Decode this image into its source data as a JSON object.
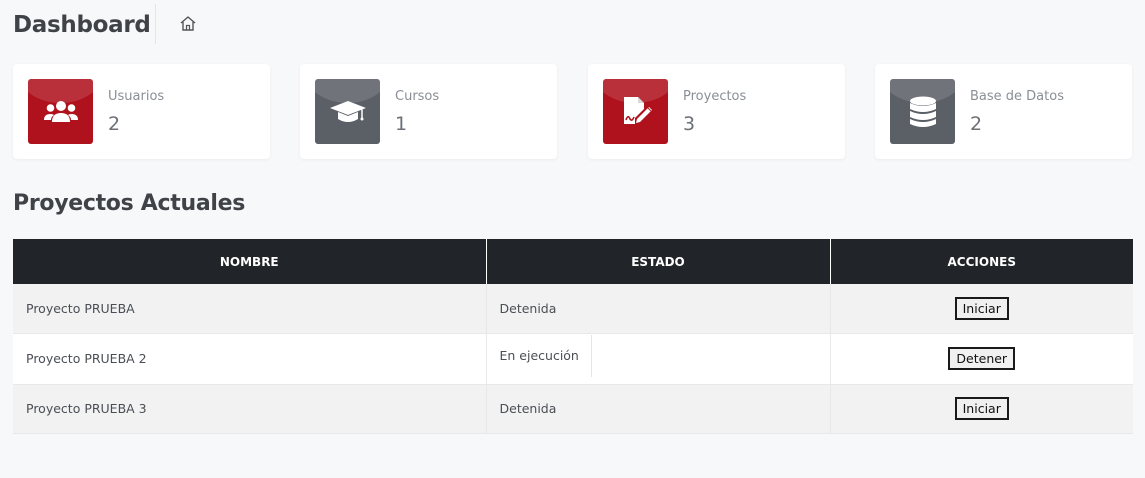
{
  "header": {
    "title": "Dashboard",
    "home_icon": "home-icon"
  },
  "colors": {
    "accent_red": "#b0121d",
    "icon_gray": "#5b5f66",
    "table_header_bg": "#212529",
    "page_bg": "#f7f8fa"
  },
  "cards": [
    {
      "label": "Usuarios",
      "value": "2",
      "icon": "users-icon",
      "color": "#b0121d"
    },
    {
      "label": "Cursos",
      "value": "1",
      "icon": "graduation-cap-icon",
      "color": "#5b5f66"
    },
    {
      "label": "Proyectos",
      "value": "3",
      "icon": "file-signature-icon",
      "color": "#b0121d"
    },
    {
      "label": "Base de Datos",
      "value": "2",
      "icon": "database-icon",
      "color": "#5b5f66"
    }
  ],
  "section": {
    "title": "Proyectos Actuales"
  },
  "table": {
    "columns": [
      "NOMBRE",
      "ESTADO",
      "ACCIONES"
    ],
    "rows": [
      {
        "nombre": "Proyecto PRUEBA",
        "estado": "Detenida",
        "accion": "Iniciar"
      },
      {
        "nombre": "Proyecto PRUEBA 2",
        "estado": "En ejecución",
        "accion": "Detener"
      },
      {
        "nombre": "Proyecto PRUEBA 3",
        "estado": "Detenida",
        "accion": "Iniciar"
      }
    ]
  }
}
